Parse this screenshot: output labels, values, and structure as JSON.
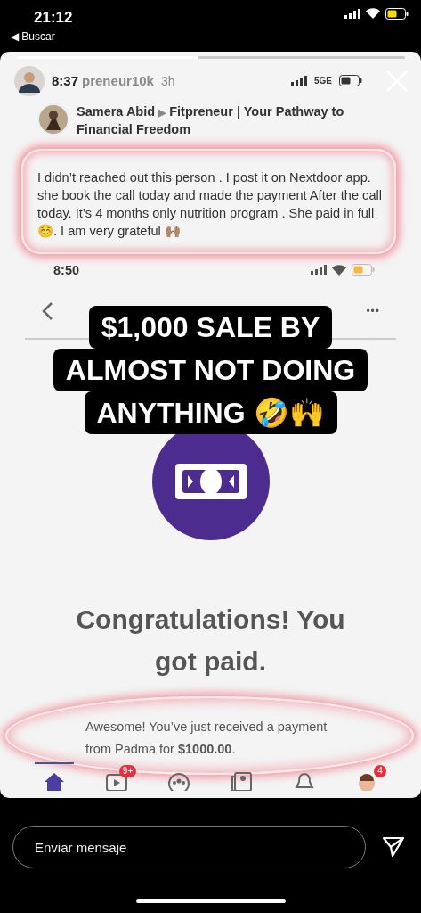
{
  "status_bar": {
    "time": "21:12",
    "back_label": "◀ Buscar"
  },
  "story": {
    "progress": [
      {
        "level": 0.47
      }
    ],
    "header": {
      "time": "8:37",
      "username": "preneur10k",
      "age": "3h",
      "network": "5GE"
    },
    "post": {
      "author": "Samera Abid",
      "arrow": "▶",
      "group": "Fitpreneur | Your Pathway to Financial Freedom",
      "text": "I didn’t reached out this person . I post it on Nextdoor app.  she book the call today and made the payment After the call today. It’s 4 months only nutrition program . She paid  in full ☺️. I am very grateful 🙌🏽"
    },
    "inner_screen": {
      "time": "8:50",
      "more": "•••",
      "caption": [
        "$1,000 SALE BY",
        "ALMOST NOT DOING",
        "ANYTHING 🤣🙌"
      ],
      "title": "Congratulations! You got paid.",
      "message": "Awesome! You’ve just received a payment from Padma for **$1000.00**.",
      "nav": [
        {
          "kind": "home",
          "selected": true
        },
        {
          "kind": "video",
          "selected": false,
          "badge": "9+"
        },
        {
          "kind": "groups",
          "selected": false
        },
        {
          "kind": "news",
          "selected": false
        },
        {
          "kind": "bell",
          "selected": false
        },
        {
          "kind": "profile",
          "selected": false,
          "badge": "4"
        }
      ]
    }
  },
  "reply": {
    "placeholder": "Enviar mensaje"
  }
}
